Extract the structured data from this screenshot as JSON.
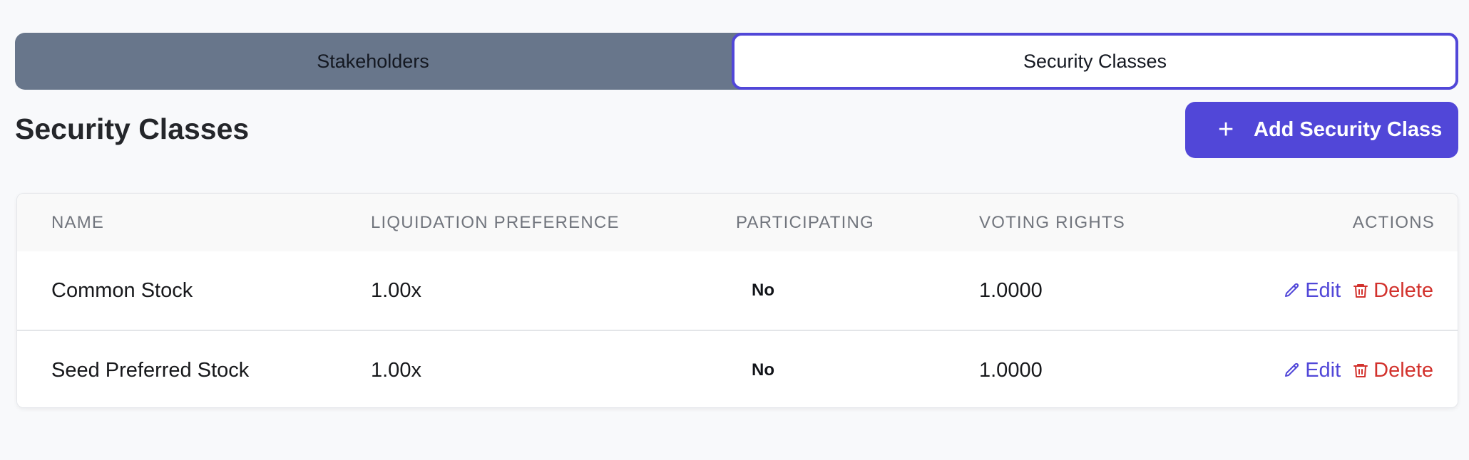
{
  "tabs": {
    "stakeholders": "Stakeholders",
    "security_classes": "Security Classes"
  },
  "page": {
    "title": "Security Classes",
    "add_button": {
      "icon": "plus-icon",
      "label": "Add Security Class"
    }
  },
  "table": {
    "headers": {
      "name": "NAME",
      "liquidation_preference": "LIQUIDATION PREFERENCE",
      "participating": "PARTICIPATING",
      "voting_rights": "VOTING RIGHTS",
      "actions": "ACTIONS"
    },
    "rows": [
      {
        "name": "Common Stock",
        "liquidation_preference": "1.00x",
        "participating": "No",
        "voting_rights": "1.0000",
        "edit": "Edit",
        "delete": "Delete"
      },
      {
        "name": "Seed Preferred Stock",
        "liquidation_preference": "1.00x",
        "participating": "No",
        "voting_rights": "1.0000",
        "edit": "Edit",
        "delete": "Delete"
      }
    ]
  },
  "colors": {
    "accent": "#5147d8",
    "danger": "#d2322d",
    "tab_bar": "#68768b",
    "background": "#f8f9fb"
  }
}
